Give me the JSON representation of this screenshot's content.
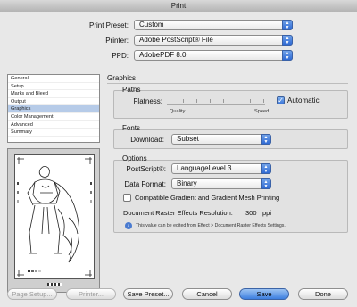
{
  "window": {
    "title": "Print"
  },
  "header": {
    "print_preset_label": "Print Preset:",
    "print_preset_value": "Custom",
    "printer_label": "Printer:",
    "printer_value": "Adobe PostScript® File",
    "ppd_label": "PPD:",
    "ppd_value": "AdobePDF 8.0"
  },
  "categories": [
    {
      "label": "General"
    },
    {
      "label": "Setup"
    },
    {
      "label": "Marks and Bleed"
    },
    {
      "label": "Output"
    },
    {
      "label": "Graphics",
      "selected": true
    },
    {
      "label": "Color Management"
    },
    {
      "label": "Advanced"
    },
    {
      "label": "Summary"
    }
  ],
  "panel": {
    "title": "Graphics",
    "paths": {
      "title": "Paths",
      "flatness_label": "Flatness:",
      "quality_label": "Quality",
      "speed_label": "Speed",
      "automatic_label": "Automatic",
      "automatic_checked": true
    },
    "fonts": {
      "title": "Fonts",
      "download_label": "Download:",
      "download_value": "Subset"
    },
    "options": {
      "title": "Options",
      "postscript_label": "PostScript®:",
      "postscript_value": "LanguageLevel 3",
      "data_format_label": "Data Format:",
      "data_format_value": "Binary",
      "compatible_gradient_label": "Compatible Gradient and Gradient Mesh Printing",
      "compatible_gradient_checked": false,
      "raster_resolution_label": "Document Raster Effects Resolution:",
      "raster_resolution_value": "300",
      "raster_resolution_unit": "ppi",
      "info_text": "This value can be edited from Effect > Document Raster Effects Settings."
    }
  },
  "buttons": {
    "page_setup": "Page Setup...",
    "printer": "Printer...",
    "save_preset": "Save Preset...",
    "cancel": "Cancel",
    "save": "Save",
    "done": "Done"
  }
}
